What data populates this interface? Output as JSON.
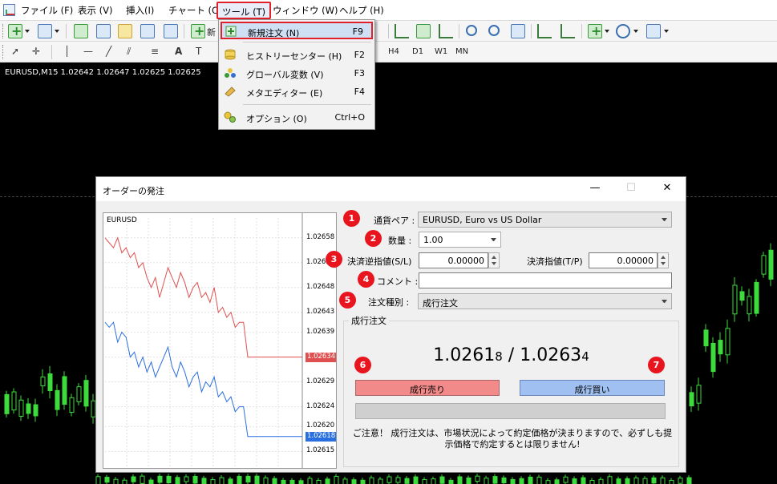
{
  "menubar": {
    "items": [
      "ファイル (F)",
      "表示 (V)",
      "挿入(I)",
      "チャート (C)",
      "ツール (T)",
      "ウィンドウ (W)",
      "ヘルプ (H)"
    ]
  },
  "toolbar": {
    "partial_label": "新",
    "timeframes": [
      "H4",
      "D1",
      "W1",
      "MN"
    ]
  },
  "chart": {
    "header": "EURUSD,M15  1.02642 1.02647 1.02625 1.02625"
  },
  "tools_menu": {
    "items": [
      {
        "label": "新規注文 (N)",
        "shortcut": "F9"
      },
      {
        "label": "ヒストリーセンター (H)",
        "shortcut": "F2"
      },
      {
        "label": "グローバル変数 (V)",
        "shortcut": "F3"
      },
      {
        "label": "メタエディター (E)",
        "shortcut": "F4"
      },
      {
        "label": "オプション (O)",
        "shortcut": "Ctrl+O"
      }
    ]
  },
  "dialog": {
    "title": "オーダーの発注",
    "window_buttons": [
      "—",
      "☐",
      "✕"
    ],
    "fields": {
      "symbol_label": "通貨ペア :",
      "symbol_value": "EURUSD, Euro vs US Dollar",
      "volume_label": "数量 :",
      "volume_value": "1.00",
      "sl_label": "決済逆指値(S/L)",
      "sl_value": "0.00000",
      "tp_label": "決済指値(T/P)",
      "tp_value": "0.00000",
      "comment_label": "コメント :",
      "type_label": "注文種別 :",
      "type_value": "成行注文"
    },
    "badges": [
      "1",
      "2",
      "3",
      "4",
      "5",
      "6",
      "7"
    ],
    "market": {
      "group_title": "成行注文",
      "bid_main": "1.0261",
      "bid_small": "8",
      "separator": " / ",
      "ask_main": "1.0263",
      "ask_small": "4",
      "sell_label": "成行売り",
      "buy_label": "成行買い",
      "notice": "ご注意！ 成行注文は、市場状況によって約定価格が決まりますので、必ずしも提示価格で約定するとは限りません!"
    }
  },
  "chart_data": {
    "type": "line",
    "title": "EURUSD",
    "ylim": [
      1.02612,
      1.02662
    ],
    "y_ticks": [
      "1.02658",
      "1.02653",
      "1.02648",
      "1.02643",
      "1.02639",
      "1.02634",
      "1.02629",
      "1.02624",
      "1.02620",
      "1.02615"
    ],
    "series": [
      {
        "color": "#e05050",
        "current": "1.02634",
        "values": [
          1.02658,
          1.02657,
          1.02656,
          1.02658,
          1.02655,
          1.02656,
          1.02654,
          1.02655,
          1.02652,
          1.02653,
          1.0265,
          1.02648,
          1.0265,
          1.02646,
          1.02649,
          1.02652,
          1.0265,
          1.02648,
          1.02651,
          1.02649,
          1.02646,
          1.02648,
          1.02649,
          1.02646,
          1.02647,
          1.02645,
          1.02648,
          1.02643,
          1.02644,
          1.02642,
          1.02643,
          1.0264,
          1.02641,
          1.02641,
          1.02634,
          1.02634,
          1.02634,
          1.02634,
          1.02634,
          1.02634,
          1.02634,
          1.02634,
          1.02634,
          1.02634,
          1.02634,
          1.02634,
          1.02634,
          1.02634
        ]
      },
      {
        "color": "#2a6fe0",
        "current": "1.02618",
        "values": [
          1.02641,
          1.0264,
          1.02641,
          1.02637,
          1.02639,
          1.02638,
          1.02634,
          1.02635,
          1.02632,
          1.02634,
          1.02631,
          1.02633,
          1.0263,
          1.02632,
          1.02634,
          1.02636,
          1.02632,
          1.0263,
          1.02633,
          1.02631,
          1.02628,
          1.0263,
          1.02631,
          1.02627,
          1.02629,
          1.02628,
          1.0263,
          1.02626,
          1.02627,
          1.02625,
          1.02626,
          1.02623,
          1.02624,
          1.02624,
          1.02618,
          1.02618,
          1.02618,
          1.02618,
          1.02618,
          1.02618,
          1.02618,
          1.02618,
          1.02618,
          1.02618,
          1.02618,
          1.02618,
          1.02618,
          1.02618
        ]
      }
    ]
  }
}
